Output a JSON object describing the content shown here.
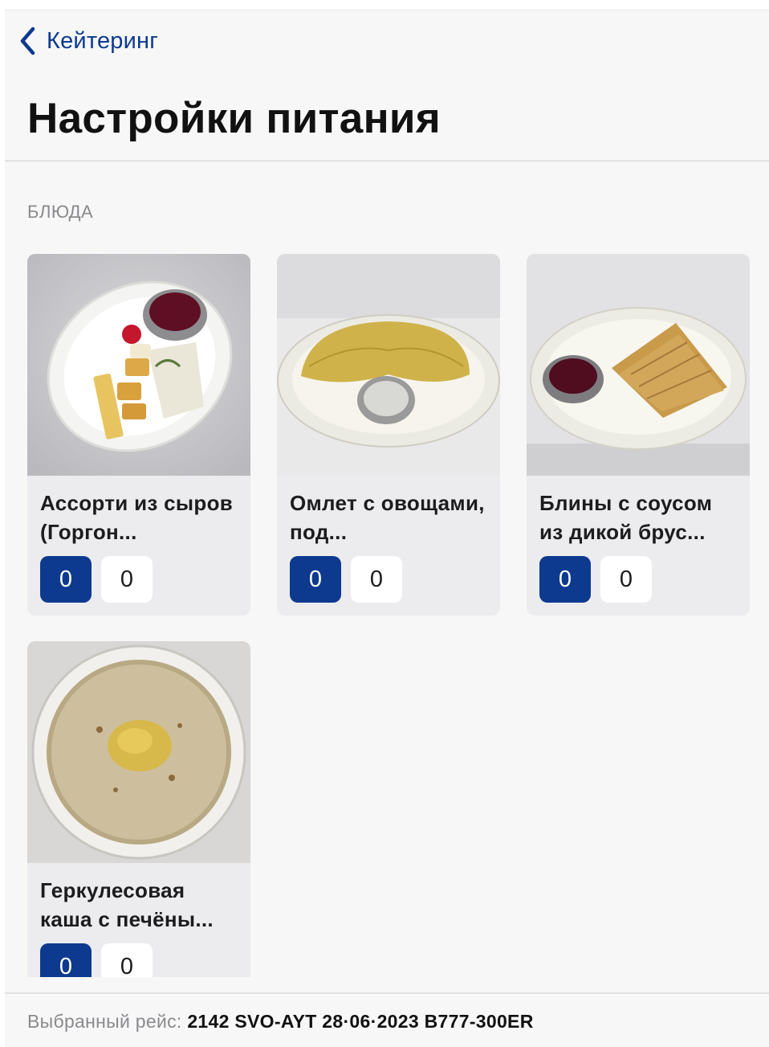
{
  "nav": {
    "back_label": "Кейтеринг",
    "title": "Настройки питания"
  },
  "section": {
    "label": "БЛЮДА"
  },
  "dishes": [
    {
      "title": "Ассорти из сыров (Горгон...",
      "count_primary": "0",
      "count_secondary": "0",
      "image": "cheese-platter-image"
    },
    {
      "title": "Омлет с овощами, под...",
      "count_primary": "0",
      "count_secondary": "0",
      "image": "omelette-image"
    },
    {
      "title": "Блины с соусом из дикой брус...",
      "count_primary": "0",
      "count_secondary": "0",
      "image": "pancakes-image"
    },
    {
      "title": "Геркулесовая каша с печёны...",
      "count_primary": "0",
      "count_secondary": "0",
      "image": "oatmeal-image"
    }
  ],
  "footer": {
    "label": "Выбранный рейс:",
    "value": "2142 SVO-AYT 28·06·2023 B777-300ER"
  },
  "colors": {
    "accent": "#0d3a8f",
    "background": "#f7f7f7",
    "card": "#ececee"
  }
}
